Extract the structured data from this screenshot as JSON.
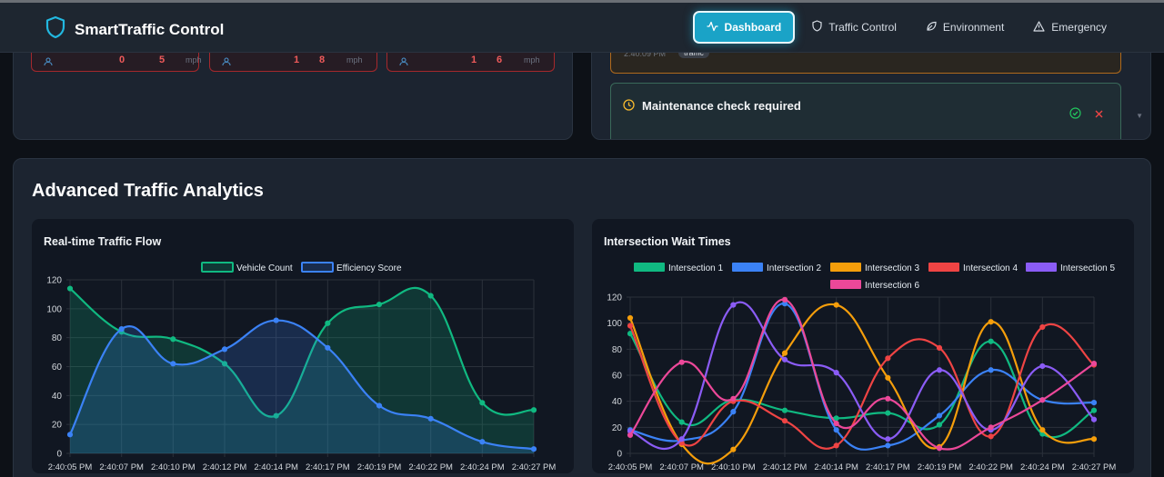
{
  "header": {
    "app_title": "SmartTraffic Control",
    "nav": [
      {
        "label": "Dashboard",
        "icon": "activity-icon",
        "active": true
      },
      {
        "label": "Traffic Control",
        "icon": "shield-icon",
        "active": false
      },
      {
        "label": "Environment",
        "icon": "leaf-icon",
        "active": false
      },
      {
        "label": "Emergency",
        "icon": "warning-icon",
        "active": false
      }
    ]
  },
  "vehicle_cards": [
    {
      "count": "0",
      "speed": "5",
      "unit": "mph"
    },
    {
      "count": "1",
      "speed": "8",
      "unit": "mph"
    },
    {
      "count": "1",
      "speed": "6",
      "unit": "mph"
    }
  ],
  "alerts": {
    "partial": {
      "time": "2:40:09 PM",
      "tag": "traffic"
    },
    "maintenance": {
      "title": "Maintenance check required"
    }
  },
  "analytics": {
    "title": "Advanced Traffic Analytics"
  },
  "colors": {
    "accent": "#1aa3c7",
    "i1": "#10b981",
    "i2": "#3b82f6",
    "i3": "#f59e0b",
    "i4": "#ef4444",
    "i5": "#8b5cf6",
    "i6": "#ec4899"
  },
  "chart_data": [
    {
      "type": "area",
      "title": "Real-time Traffic Flow",
      "categories": [
        "2:40:05 PM",
        "2:40:07 PM",
        "2:40:10 PM",
        "2:40:12 PM",
        "2:40:14 PM",
        "2:40:17 PM",
        "2:40:19 PM",
        "2:40:22 PM",
        "2:40:24 PM",
        "2:40:27 PM"
      ],
      "ylim": [
        0,
        120
      ],
      "yticks": [
        0,
        20,
        40,
        60,
        80,
        100,
        120
      ],
      "legend": "top-center",
      "grid": true,
      "series": [
        {
          "name": "Vehicle Count",
          "color": "#10b981",
          "values": [
            114,
            84,
            79,
            62,
            26,
            90,
            103,
            109,
            35,
            30
          ]
        },
        {
          "name": "Efficiency Score",
          "color": "#3b82f6",
          "values": [
            13,
            86,
            62,
            72,
            92,
            73,
            33,
            24,
            8,
            3
          ]
        }
      ]
    },
    {
      "type": "line",
      "title": "Intersection Wait Times",
      "categories": [
        "2:40:05 PM",
        "2:40:07 PM",
        "2:40:10 PM",
        "2:40:12 PM",
        "2:40:14 PM",
        "2:40:17 PM",
        "2:40:19 PM",
        "2:40:22 PM",
        "2:40:24 PM",
        "2:40:27 PM"
      ],
      "ylim": [
        0,
        120
      ],
      "yticks": [
        0,
        20,
        40,
        60,
        80,
        100,
        120
      ],
      "legend": "top-center",
      "grid": true,
      "series": [
        {
          "name": "Intersection 1",
          "color": "#10b981",
          "values": [
            92,
            24,
            41,
            33,
            27,
            31,
            22,
            86,
            15,
            33
          ]
        },
        {
          "name": "Intersection 2",
          "color": "#3b82f6",
          "values": [
            18,
            10,
            32,
            115,
            18,
            6,
            29,
            64,
            41,
            39
          ]
        },
        {
          "name": "Intersection 3",
          "color": "#f59e0b",
          "values": [
            104,
            7,
            3,
            77,
            114,
            58,
            5,
            101,
            18,
            11
          ]
        },
        {
          "name": "Intersection 4",
          "color": "#ef4444",
          "values": [
            98,
            8,
            40,
            25,
            6,
            73,
            81,
            13,
            97,
            68
          ]
        },
        {
          "name": "Intersection 5",
          "color": "#8b5cf6",
          "values": [
            17,
            11,
            114,
            72,
            62,
            11,
            64,
            18,
            67,
            26
          ]
        },
        {
          "name": "Intersection 6",
          "color": "#ec4899",
          "values": [
            14,
            70,
            42,
            118,
            23,
            42,
            4,
            20,
            41,
            69
          ]
        }
      ]
    }
  ]
}
